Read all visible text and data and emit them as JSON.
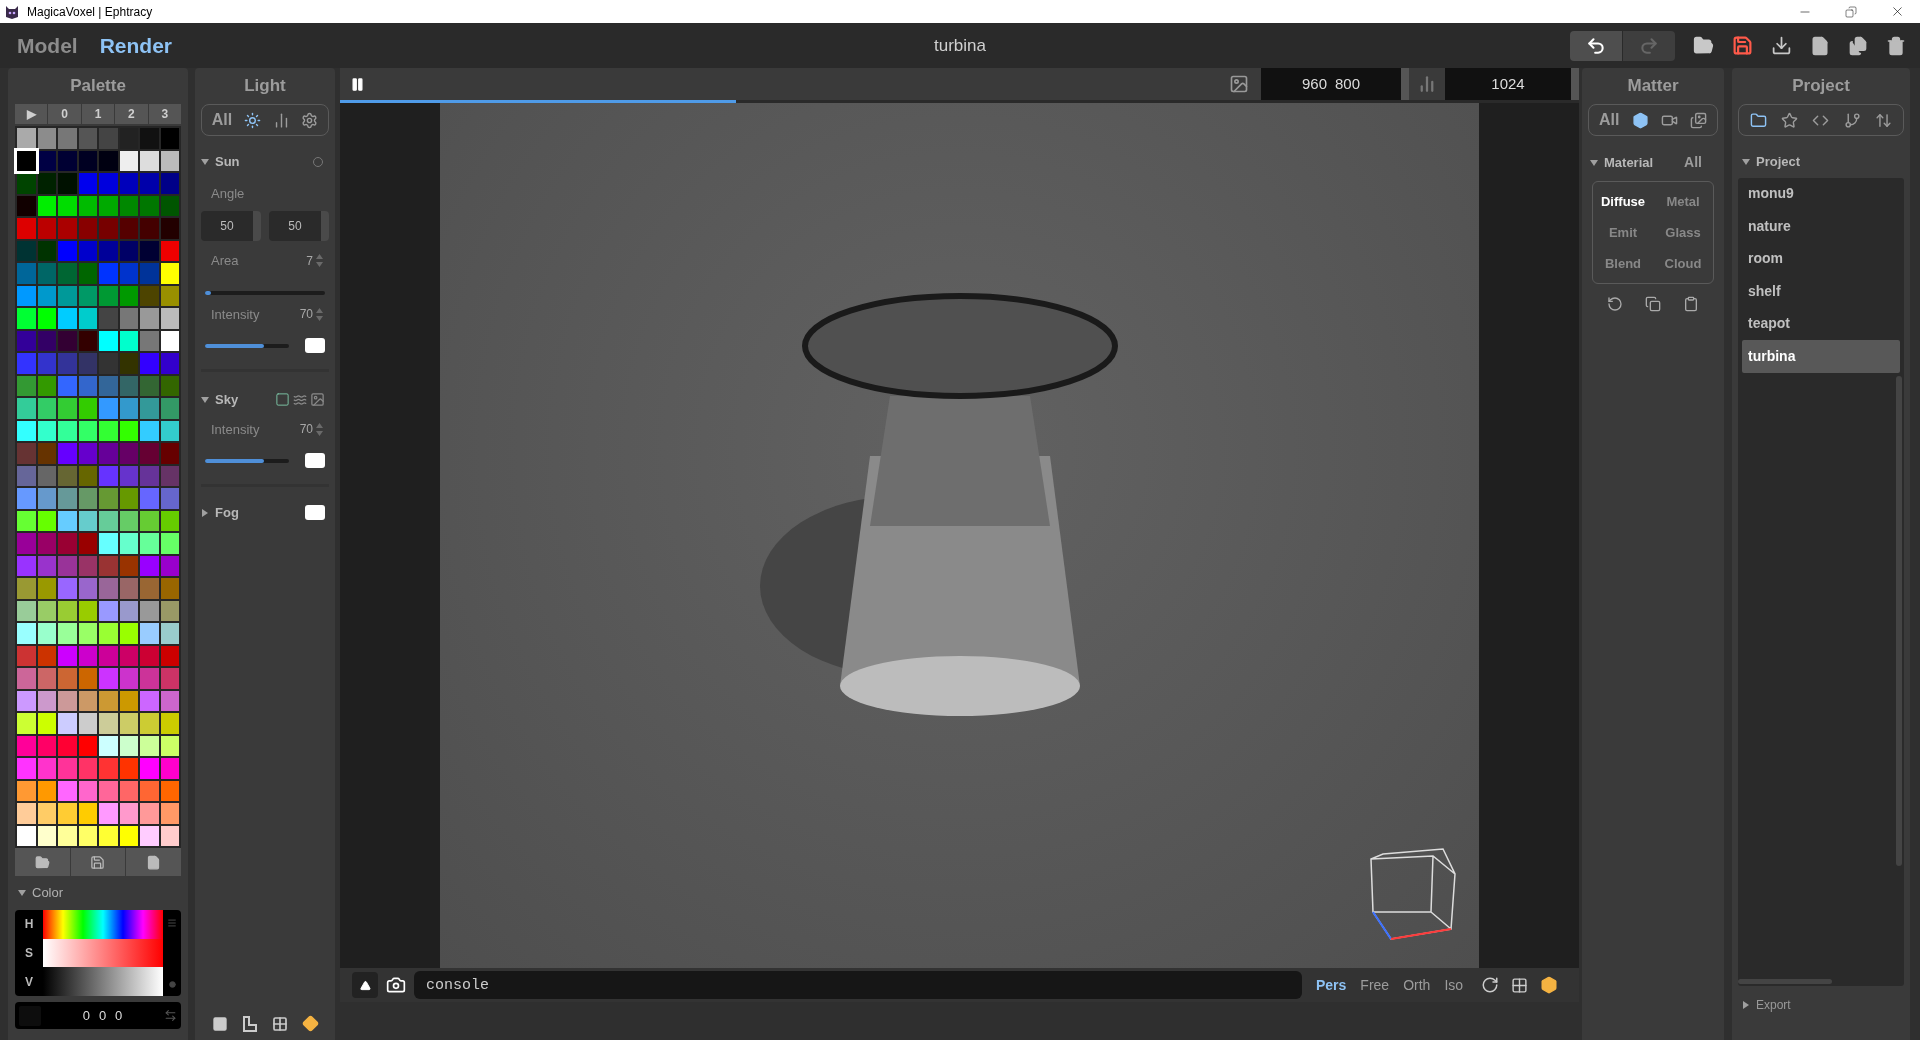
{
  "title_bar": {
    "title": "MagicaVoxel | Ephtracy"
  },
  "mode_tabs": [
    {
      "label": "Model",
      "selected": false
    },
    {
      "label": "Render",
      "selected": true
    }
  ],
  "document_title": "turbina",
  "toolbar": {
    "undo_enabled": true,
    "redo_enabled": false
  },
  "palette": {
    "title": "Palette",
    "pages": [
      "▶",
      "0",
      "1",
      "2",
      "3"
    ],
    "rows": [
      [
        {
          "color": "#aaaaaa",
          "selected": false
        },
        {
          "color": "#8c8c8c",
          "selected": false
        },
        {
          "color": "#777777",
          "selected": false
        },
        {
          "color": "#555555",
          "selected": false
        },
        {
          "color": "#444444",
          "selected": false
        },
        {
          "color": "#222222",
          "selected": false
        },
        {
          "color": "#111111",
          "selected": false
        },
        {
          "color": "#000000",
          "selected": false
        }
      ],
      [
        {
          "color": "#000000",
          "selected": true
        },
        {
          "color": "#000044",
          "selected": false
        },
        {
          "color": "#000033",
          "selected": false
        },
        {
          "color": "#000022",
          "selected": false
        },
        {
          "color": "#000011",
          "selected": false
        },
        {
          "color": "#eeeeee",
          "selected": false
        },
        {
          "color": "#dddddd",
          "selected": false
        },
        {
          "color": "#bbbbbb",
          "selected": false
        }
      ],
      [
        {
          "color": "#004400",
          "selected": false
        },
        {
          "color": "#002200",
          "selected": false
        },
        {
          "color": "#001100",
          "selected": false
        },
        {
          "color": "#0000ee",
          "selected": false
        },
        {
          "color": "#0000dd",
          "selected": false
        },
        {
          "color": "#0000bb",
          "selected": false
        },
        {
          "color": "#0000aa",
          "selected": false
        },
        {
          "color": "#000088",
          "selected": false
        }
      ],
      [
        {
          "color": "#110000",
          "selected": false
        },
        {
          "color": "#00ee00",
          "selected": false
        },
        {
          "color": "#00dd00",
          "selected": false
        },
        {
          "color": "#00bb00",
          "selected": false
        },
        {
          "color": "#00aa00",
          "selected": false
        },
        {
          "color": "#008800",
          "selected": false
        },
        {
          "color": "#007700",
          "selected": false
        },
        {
          "color": "#005500",
          "selected": false
        }
      ],
      [
        {
          "color": "#dd0000",
          "selected": false
        },
        {
          "color": "#bb0000",
          "selected": false
        },
        {
          "color": "#aa0000",
          "selected": false
        },
        {
          "color": "#880000",
          "selected": false
        },
        {
          "color": "#770000",
          "selected": false
        },
        {
          "color": "#550000",
          "selected": false
        },
        {
          "color": "#440000",
          "selected": false
        },
        {
          "color": "#220000",
          "selected": false
        }
      ],
      [
        {
          "color": "#003333",
          "selected": false
        },
        {
          "color": "#003300",
          "selected": false
        },
        {
          "color": "#0000ff",
          "selected": false
        },
        {
          "color": "#0000cc",
          "selected": false
        },
        {
          "color": "#000099",
          "selected": false
        },
        {
          "color": "#000066",
          "selected": false
        },
        {
          "color": "#000033",
          "selected": false
        },
        {
          "color": "#ee0000",
          "selected": false
        }
      ],
      [
        {
          "color": "#006699",
          "selected": false
        },
        {
          "color": "#006666",
          "selected": false
        },
        {
          "color": "#006633",
          "selected": false
        },
        {
          "color": "#006600",
          "selected": false
        },
        {
          "color": "#0033ff",
          "selected": false
        },
        {
          "color": "#0033cc",
          "selected": false
        },
        {
          "color": "#003399",
          "selected": false
        },
        {
          "color": "#ffff00",
          "selected": false
        }
      ],
      [
        {
          "color": "#0099ff",
          "selected": false
        },
        {
          "color": "#0099cc",
          "selected": false
        },
        {
          "color": "#009999",
          "selected": false
        },
        {
          "color": "#009966",
          "selected": false
        },
        {
          "color": "#009933",
          "selected": false
        },
        {
          "color": "#009900",
          "selected": false
        },
        {
          "color": "#4d4400",
          "selected": false
        },
        {
          "color": "#999000",
          "selected": false
        }
      ],
      [
        {
          "color": "#00ff33",
          "selected": false
        },
        {
          "color": "#00ff00",
          "selected": false
        },
        {
          "color": "#00ccff",
          "selected": false
        },
        {
          "color": "#00cccc",
          "selected": false
        },
        {
          "color": "#444444",
          "selected": false
        },
        {
          "color": "#777777",
          "selected": false
        },
        {
          "color": "#999999",
          "selected": false
        },
        {
          "color": "#bbbbbb",
          "selected": false
        }
      ],
      [
        {
          "color": "#330099",
          "selected": false
        },
        {
          "color": "#330066",
          "selected": false
        },
        {
          "color": "#330033",
          "selected": false
        },
        {
          "color": "#330000",
          "selected": false
        },
        {
          "color": "#00ffff",
          "selected": false
        },
        {
          "color": "#00ffcc",
          "selected": false
        },
        {
          "color": "#777777",
          "selected": false
        },
        {
          "color": "#ffffff",
          "selected": false
        }
      ],
      [
        {
          "color": "#3333ff",
          "selected": false
        },
        {
          "color": "#3333cc",
          "selected": false
        },
        {
          "color": "#333399",
          "selected": false
        },
        {
          "color": "#333366",
          "selected": false
        },
        {
          "color": "#333333",
          "selected": false
        },
        {
          "color": "#333300",
          "selected": false
        },
        {
          "color": "#3300ff",
          "selected": false
        },
        {
          "color": "#3300cc",
          "selected": false
        }
      ],
      [
        {
          "color": "#339933",
          "selected": false
        },
        {
          "color": "#339900",
          "selected": false
        },
        {
          "color": "#3366ff",
          "selected": false
        },
        {
          "color": "#3366cc",
          "selected": false
        },
        {
          "color": "#336699",
          "selected": false
        },
        {
          "color": "#336666",
          "selected": false
        },
        {
          "color": "#336633",
          "selected": false
        },
        {
          "color": "#336600",
          "selected": false
        }
      ],
      [
        {
          "color": "#33cc99",
          "selected": false
        },
        {
          "color": "#33cc66",
          "selected": false
        },
        {
          "color": "#33cc33",
          "selected": false
        },
        {
          "color": "#33cc00",
          "selected": false
        },
        {
          "color": "#3399ff",
          "selected": false
        },
        {
          "color": "#3399cc",
          "selected": false
        },
        {
          "color": "#339999",
          "selected": false
        },
        {
          "color": "#339966",
          "selected": false
        }
      ],
      [
        {
          "color": "#33ffff",
          "selected": false
        },
        {
          "color": "#33ffcc",
          "selected": false
        },
        {
          "color": "#33ff99",
          "selected": false
        },
        {
          "color": "#33ff66",
          "selected": false
        },
        {
          "color": "#33ff33",
          "selected": false
        },
        {
          "color": "#33ff00",
          "selected": false
        },
        {
          "color": "#33ccff",
          "selected": false
        },
        {
          "color": "#33cccc",
          "selected": false
        }
      ],
      [
        {
          "color": "#663333",
          "selected": false
        },
        {
          "color": "#663300",
          "selected": false
        },
        {
          "color": "#6600ff",
          "selected": false
        },
        {
          "color": "#6600cc",
          "selected": false
        },
        {
          "color": "#660099",
          "selected": false
        },
        {
          "color": "#660066",
          "selected": false
        },
        {
          "color": "#660033",
          "selected": false
        },
        {
          "color": "#660000",
          "selected": false
        }
      ],
      [
        {
          "color": "#666699",
          "selected": false
        },
        {
          "color": "#666666",
          "selected": false
        },
        {
          "color": "#666633",
          "selected": false
        },
        {
          "color": "#666600",
          "selected": false
        },
        {
          "color": "#6633ff",
          "selected": false
        },
        {
          "color": "#6633cc",
          "selected": false
        },
        {
          "color": "#663399",
          "selected": false
        },
        {
          "color": "#663366",
          "selected": false
        }
      ],
      [
        {
          "color": "#6699ff",
          "selected": false
        },
        {
          "color": "#6699cc",
          "selected": false
        },
        {
          "color": "#669999",
          "selected": false
        },
        {
          "color": "#669966",
          "selected": false
        },
        {
          "color": "#669933",
          "selected": false
        },
        {
          "color": "#669900",
          "selected": false
        },
        {
          "color": "#6666ff",
          "selected": false
        },
        {
          "color": "#6666cc",
          "selected": false
        }
      ],
      [
        {
          "color": "#66ff33",
          "selected": false
        },
        {
          "color": "#66ff00",
          "selected": false
        },
        {
          "color": "#66ccff",
          "selected": false
        },
        {
          "color": "#66cccc",
          "selected": false
        },
        {
          "color": "#66cc99",
          "selected": false
        },
        {
          "color": "#66cc66",
          "selected": false
        },
        {
          "color": "#66cc33",
          "selected": false
        },
        {
          "color": "#66cc00",
          "selected": false
        }
      ],
      [
        {
          "color": "#990099",
          "selected": false
        },
        {
          "color": "#990066",
          "selected": false
        },
        {
          "color": "#990033",
          "selected": false
        },
        {
          "color": "#990000",
          "selected": false
        },
        {
          "color": "#66ffff",
          "selected": false
        },
        {
          "color": "#66ffcc",
          "selected": false
        },
        {
          "color": "#66ff99",
          "selected": false
        },
        {
          "color": "#66ff66",
          "selected": false
        }
      ],
      [
        {
          "color": "#9933ff",
          "selected": false
        },
        {
          "color": "#9933cc",
          "selected": false
        },
        {
          "color": "#993399",
          "selected": false
        },
        {
          "color": "#993366",
          "selected": false
        },
        {
          "color": "#993333",
          "selected": false
        },
        {
          "color": "#993300",
          "selected": false
        },
        {
          "color": "#9900ff",
          "selected": false
        },
        {
          "color": "#9900cc",
          "selected": false
        }
      ],
      [
        {
          "color": "#999933",
          "selected": false
        },
        {
          "color": "#999900",
          "selected": false
        },
        {
          "color": "#9966ff",
          "selected": false
        },
        {
          "color": "#9966cc",
          "selected": false
        },
        {
          "color": "#996699",
          "selected": false
        },
        {
          "color": "#996666",
          "selected": false
        },
        {
          "color": "#996633",
          "selected": false
        },
        {
          "color": "#996600",
          "selected": false
        }
      ],
      [
        {
          "color": "#99cc99",
          "selected": false
        },
        {
          "color": "#99cc66",
          "selected": false
        },
        {
          "color": "#99cc33",
          "selected": false
        },
        {
          "color": "#99cc00",
          "selected": false
        },
        {
          "color": "#9999ff",
          "selected": false
        },
        {
          "color": "#9999cc",
          "selected": false
        },
        {
          "color": "#999999",
          "selected": false
        },
        {
          "color": "#999966",
          "selected": false
        }
      ],
      [
        {
          "color": "#99ffff",
          "selected": false
        },
        {
          "color": "#99ffcc",
          "selected": false
        },
        {
          "color": "#99ff99",
          "selected": false
        },
        {
          "color": "#99ff66",
          "selected": false
        },
        {
          "color": "#99ff33",
          "selected": false
        },
        {
          "color": "#99ff00",
          "selected": false
        },
        {
          "color": "#99ccff",
          "selected": false
        },
        {
          "color": "#99cccc",
          "selected": false
        }
      ],
      [
        {
          "color": "#cc3333",
          "selected": false
        },
        {
          "color": "#cc3300",
          "selected": false
        },
        {
          "color": "#cc00ff",
          "selected": false
        },
        {
          "color": "#cc00cc",
          "selected": false
        },
        {
          "color": "#cc0099",
          "selected": false
        },
        {
          "color": "#cc0066",
          "selected": false
        },
        {
          "color": "#cc0033",
          "selected": false
        },
        {
          "color": "#cc0000",
          "selected": false
        }
      ],
      [
        {
          "color": "#cc6699",
          "selected": false
        },
        {
          "color": "#cc6666",
          "selected": false
        },
        {
          "color": "#cc6633",
          "selected": false
        },
        {
          "color": "#cc6600",
          "selected": false
        },
        {
          "color": "#cc33ff",
          "selected": false
        },
        {
          "color": "#cc33cc",
          "selected": false
        },
        {
          "color": "#cc3399",
          "selected": false
        },
        {
          "color": "#cc3366",
          "selected": false
        }
      ],
      [
        {
          "color": "#cc99ff",
          "selected": false
        },
        {
          "color": "#cc99cc",
          "selected": false
        },
        {
          "color": "#cc9999",
          "selected": false
        },
        {
          "color": "#cc9966",
          "selected": false
        },
        {
          "color": "#cc9933",
          "selected": false
        },
        {
          "color": "#cc9900",
          "selected": false
        },
        {
          "color": "#cc66ff",
          "selected": false
        },
        {
          "color": "#cc66cc",
          "selected": false
        }
      ],
      [
        {
          "color": "#ccff33",
          "selected": false
        },
        {
          "color": "#ccff00",
          "selected": false
        },
        {
          "color": "#ccccff",
          "selected": false
        },
        {
          "color": "#cccccc",
          "selected": false
        },
        {
          "color": "#cccc99",
          "selected": false
        },
        {
          "color": "#cccc66",
          "selected": false
        },
        {
          "color": "#cccc33",
          "selected": false
        },
        {
          "color": "#cccc00",
          "selected": false
        }
      ],
      [
        {
          "color": "#ff0099",
          "selected": false
        },
        {
          "color": "#ff0066",
          "selected": false
        },
        {
          "color": "#ff0033",
          "selected": false
        },
        {
          "color": "#ff0000",
          "selected": false
        },
        {
          "color": "#ccffff",
          "selected": false
        },
        {
          "color": "#ccffcc",
          "selected": false
        },
        {
          "color": "#ccff99",
          "selected": false
        },
        {
          "color": "#ccff66",
          "selected": false
        }
      ],
      [
        {
          "color": "#ff33ff",
          "selected": false
        },
        {
          "color": "#ff33cc",
          "selected": false
        },
        {
          "color": "#ff3399",
          "selected": false
        },
        {
          "color": "#ff3366",
          "selected": false
        },
        {
          "color": "#ff3333",
          "selected": false
        },
        {
          "color": "#ff3300",
          "selected": false
        },
        {
          "color": "#ff00ff",
          "selected": false
        },
        {
          "color": "#ff00cc",
          "selected": false
        }
      ],
      [
        {
          "color": "#ff9933",
          "selected": false
        },
        {
          "color": "#ff9900",
          "selected": false
        },
        {
          "color": "#ff66ff",
          "selected": false
        },
        {
          "color": "#ff66cc",
          "selected": false
        },
        {
          "color": "#ff6699",
          "selected": false
        },
        {
          "color": "#ff6666",
          "selected": false
        },
        {
          "color": "#ff6633",
          "selected": false
        },
        {
          "color": "#ff6600",
          "selected": false
        }
      ],
      [
        {
          "color": "#ffcc99",
          "selected": false
        },
        {
          "color": "#ffcc66",
          "selected": false
        },
        {
          "color": "#ffcc33",
          "selected": false
        },
        {
          "color": "#ffcc00",
          "selected": false
        },
        {
          "color": "#ff99ff",
          "selected": false
        },
        {
          "color": "#ff99cc",
          "selected": false
        },
        {
          "color": "#ff9999",
          "selected": false
        },
        {
          "color": "#ff9966",
          "selected": false
        }
      ],
      [
        {
          "color": "#ffffff",
          "selected": false
        },
        {
          "color": "#ffffcc",
          "selected": false
        },
        {
          "color": "#ffff99",
          "selected": false
        },
        {
          "color": "#ffff66",
          "selected": false
        },
        {
          "color": "#ffff33",
          "selected": false
        },
        {
          "color": "#ffff00",
          "selected": false
        },
        {
          "color": "#ffccff",
          "selected": false
        },
        {
          "color": "#ffcccc",
          "selected": false
        }
      ]
    ]
  },
  "color_editor": {
    "title": "Color",
    "expanded": true,
    "channels": [
      "H",
      "S",
      "V"
    ],
    "values": [
      "0",
      "0",
      "0"
    ]
  },
  "light": {
    "title": "Light",
    "filters": [
      {
        "kind": "text",
        "label": "All",
        "selected": false
      },
      {
        "kind": "sun",
        "selected": true
      },
      {
        "kind": "chart",
        "selected": false
      },
      {
        "kind": "settings",
        "selected": false
      }
    ],
    "sun": {
      "label": "Sun",
      "expanded": true,
      "enabled": false,
      "angle_label": "Angle",
      "angles": [
        "50",
        "50"
      ],
      "area": {
        "label": "Area",
        "value": "7",
        "level": 0.05
      },
      "intensity": {
        "label": "Intensity",
        "value": "70",
        "level": 0.7
      }
    },
    "sky": {
      "label": "Sky",
      "expanded": true,
      "modes": [
        {
          "kind": "uniform",
          "selected": true
        },
        {
          "kind": "waves",
          "selected": false
        },
        {
          "kind": "image",
          "selected": false
        }
      ],
      "intensity": {
        "label": "Intensity",
        "value": "70",
        "level": 0.7
      }
    },
    "fog": {
      "label": "Fog",
      "expanded": false
    }
  },
  "render_bar": {
    "progress": {
      "level": 0.32
    },
    "size": [
      "960",
      "800"
    ],
    "samples": "1024"
  },
  "console": {
    "value": "console"
  },
  "camera_modes": [
    {
      "label": "Pers",
      "selected": true
    },
    {
      "label": "Free",
      "selected": false
    },
    {
      "label": "Orth",
      "selected": false
    },
    {
      "label": "Iso",
      "selected": false
    }
  ],
  "matter": {
    "title": "Matter",
    "filters": [
      {
        "kind": "text",
        "label": "All",
        "selected": false
      },
      {
        "kind": "cube",
        "selected": true
      },
      {
        "kind": "camera",
        "selected": false
      },
      {
        "kind": "image",
        "selected": false
      }
    ],
    "material": {
      "label": "Material",
      "scope": "All",
      "expanded": true,
      "types": [
        {
          "label": "Diffuse",
          "selected": true
        },
        {
          "label": "Metal",
          "selected": false
        },
        {
          "label": "Emit",
          "selected": false
        },
        {
          "label": "Glass",
          "selected": false
        },
        {
          "label": "Blend",
          "selected": false
        },
        {
          "label": "Cloud",
          "selected": false
        }
      ]
    }
  },
  "project": {
    "title": "Project",
    "filters": [
      {
        "kind": "folder",
        "selected": true
      },
      {
        "kind": "star",
        "selected": false
      },
      {
        "kind": "code",
        "selected": false
      },
      {
        "kind": "branch",
        "selected": false
      },
      {
        "kind": "sort",
        "selected": false
      }
    ],
    "section": {
      "label": "Project",
      "expanded": true
    },
    "items": [
      {
        "label": "monu9",
        "selected": false
      },
      {
        "label": "nature",
        "selected": false
      },
      {
        "label": "room",
        "selected": false
      },
      {
        "label": "shelf",
        "selected": false
      },
      {
        "label": "teapot",
        "selected": false
      },
      {
        "label": "turbina",
        "selected": true
      }
    ],
    "export": {
      "label": "Export",
      "expanded": false
    }
  }
}
